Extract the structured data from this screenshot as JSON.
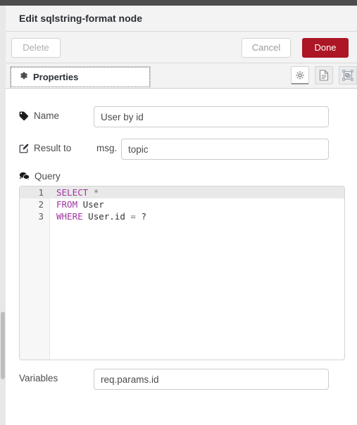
{
  "dialog": {
    "title": "Edit sqlstring-format node",
    "buttons": {
      "delete": "Delete",
      "cancel": "Cancel",
      "done": "Done"
    },
    "done_color": "#ad1625"
  },
  "tabs": [
    {
      "label": "Properties",
      "icon": "gear-icon",
      "active": true
    }
  ],
  "toolbar_icons": [
    {
      "name": "gear-icon",
      "active": true
    },
    {
      "name": "description-icon",
      "active": false
    },
    {
      "name": "appearance-icon",
      "active": false
    }
  ],
  "form": {
    "name": {
      "label": "Name",
      "icon": "tag-icon",
      "value": "User by id",
      "placeholder": "Name"
    },
    "result_to": {
      "label": "Result to",
      "icon": "edit-icon",
      "prefix": "msg.",
      "value": "topic",
      "placeholder": "topic"
    },
    "query": {
      "label": "Query",
      "icon": "comments-icon",
      "lines": [
        {
          "number": "1",
          "active": true,
          "tokens": [
            {
              "text": "SELECT",
              "type": "keyword"
            },
            {
              "text": " ",
              "type": "plain"
            },
            {
              "text": "*",
              "type": "operator"
            }
          ]
        },
        {
          "number": "2",
          "active": false,
          "tokens": [
            {
              "text": "FROM",
              "type": "keyword"
            },
            {
              "text": " User",
              "type": "plain"
            }
          ]
        },
        {
          "number": "3",
          "active": false,
          "tokens": [
            {
              "text": "WHERE",
              "type": "keyword"
            },
            {
              "text": " User.id ",
              "type": "plain"
            },
            {
              "text": "=",
              "type": "operator"
            },
            {
              "text": " ",
              "type": "plain"
            },
            {
              "text": "?",
              "type": "plain"
            }
          ]
        }
      ],
      "keyword_color": "#a035a0",
      "operator_color": "#6b7a85"
    },
    "variables": {
      "label": "Variables",
      "value": "req.params.id",
      "placeholder": "Variables"
    }
  }
}
